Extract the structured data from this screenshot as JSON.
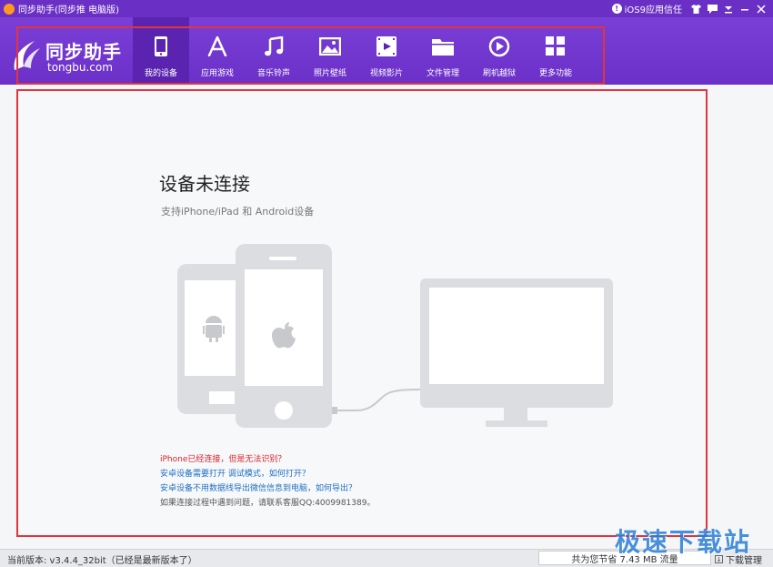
{
  "window": {
    "title": "同步助手(同步推 电脑版)",
    "trust_label": "iOS9应用信任"
  },
  "logo": {
    "name": "同步助手",
    "domain": "tongbu.com"
  },
  "nav": [
    {
      "label": "我的设备",
      "icon": "phone-icon",
      "active": true
    },
    {
      "label": "应用游戏",
      "icon": "app-store-icon",
      "active": false
    },
    {
      "label": "音乐铃声",
      "icon": "music-note-icon",
      "active": false
    },
    {
      "label": "照片壁纸",
      "icon": "picture-icon",
      "active": false
    },
    {
      "label": "视频影片",
      "icon": "film-icon",
      "active": false
    },
    {
      "label": "文件管理",
      "icon": "folder-icon",
      "active": false
    },
    {
      "label": "刷机越狱",
      "icon": "flash-icon",
      "active": false
    },
    {
      "label": "更多功能",
      "icon": "grid-icon",
      "active": false
    }
  ],
  "main": {
    "heading": "设备未连接",
    "subheading": "支持iPhone/iPad 和 Android设备",
    "links": {
      "iphone_issue": "iPhone已经连接，但是无法识别？",
      "android_debug": "安卓设备需要打开 调试模式，如何打开？",
      "wechat_export": "安卓设备不用数据线导出微信信息到电脑，如何导出？",
      "contact": "如果连接过程中遇到问题，请联系客服QQ:4009981389。"
    }
  },
  "status": {
    "version": "当前版本: v3.4.4_32bit（已经是最新版本了）",
    "saved": "共为您节省  7.43 MB 流量",
    "download_manager": "下载管理"
  },
  "watermark": "极速下载站",
  "colors": {
    "brand": "#6a2fc4",
    "highlight": "#e2343f",
    "link": "#1f6fc1",
    "warn": "#d9232c"
  }
}
